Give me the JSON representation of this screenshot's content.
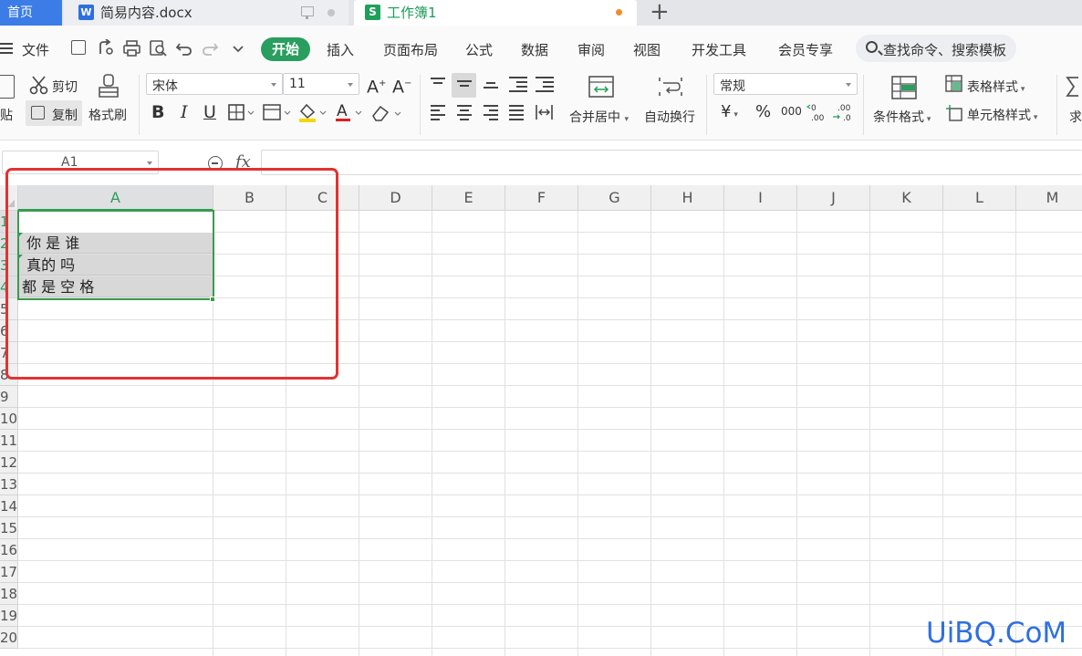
{
  "tabs": {
    "home": "首页",
    "doc": "简易内容.docx",
    "doc_icon": "W",
    "sheet": "工作簿1",
    "sheet_icon": "S",
    "add": "+"
  },
  "menu": {
    "file": "文件",
    "start": "开始",
    "items": [
      "插入",
      "页面布局",
      "公式",
      "数据",
      "审阅",
      "视图",
      "开发工具",
      "会员专享"
    ],
    "search_placeholder": "查找命令、搜索模板"
  },
  "ribbon": {
    "paste": "贴",
    "cut": "剪切",
    "copy": "复制",
    "format_painter": "格式刷",
    "font_name": "宋体",
    "font_size": "11",
    "bold": "B",
    "italic": "I",
    "underline": "U",
    "merge_center": "合并居中",
    "wrap_text": "自动换行",
    "number_format": "常规",
    "currency": "¥",
    "percent": "%",
    "thousands": "000",
    "cond_format": "条件格式",
    "table_style": "表格样式",
    "cell_style": "单元格样式",
    "sum_partial": "求"
  },
  "formula_bar": {
    "name_box": "A1",
    "fx": "fx",
    "content": ""
  },
  "grid": {
    "columns": [
      "A",
      "B",
      "C",
      "D",
      "E",
      "F",
      "G",
      "H",
      "I",
      "J",
      "K",
      "L",
      "M"
    ],
    "rows": [
      "1",
      "2",
      "3",
      "4",
      "5",
      "6",
      "7",
      "8",
      "9",
      "10",
      "11",
      "12",
      "13",
      "14",
      "15",
      "16",
      "17",
      "18",
      "19",
      "20"
    ],
    "selected_column": "A",
    "cells": {
      "A2": " 你 是 谁",
      "A3": " 真的 吗",
      "A4": "都 是 空 格"
    }
  },
  "watermark": "UiBQ.CoM",
  "colors": {
    "accent_green": "#2a9e5e",
    "selection_green": "#3c9a4d",
    "annotation_red": "#e23232",
    "home_tab_blue": "#3c7ce6",
    "watermark_blue": "#2f6fe0"
  }
}
